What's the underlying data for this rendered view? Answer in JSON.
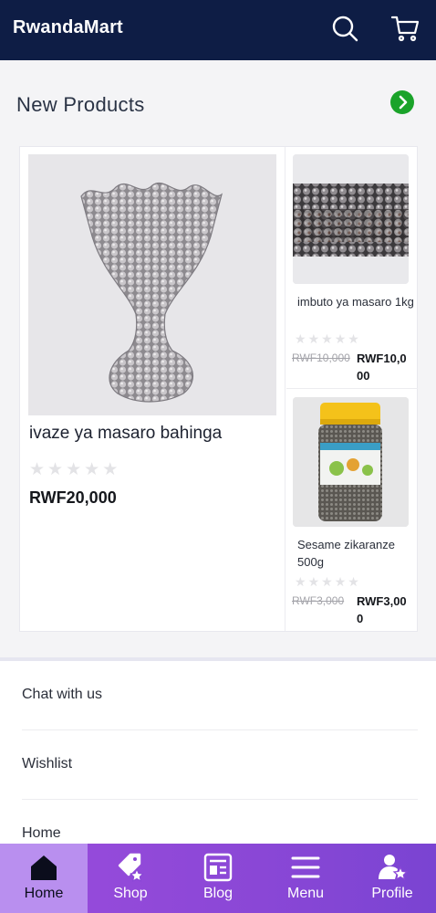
{
  "app": {
    "brand": "RwandaMart",
    "icons": {
      "search": "search-icon",
      "cart": "cart-icon"
    }
  },
  "section": {
    "title": "New Products",
    "more_icon": "chevron-right-icon"
  },
  "products": {
    "featured": {
      "name": "ivaze ya masaro bahinga",
      "rating": 0,
      "price": "RWF20,000"
    },
    "side": [
      {
        "name": "imbuto ya masaro 1kg",
        "rating": 0,
        "old_price": "RWF10,000",
        "price": "RWF10,000"
      },
      {
        "name": "Sesame zikaranze 500g",
        "rating": 0,
        "old_price": "RWF3,000",
        "price": "RWF3,000"
      }
    ]
  },
  "menu": {
    "items": [
      "Chat with us",
      "Wishlist",
      "Home"
    ]
  },
  "bottom_nav": {
    "items": [
      {
        "label": "Home",
        "icon": "home-icon",
        "active": true
      },
      {
        "label": "Shop",
        "icon": "shop-tag-icon",
        "active": false
      },
      {
        "label": "Blog",
        "icon": "blog-icon",
        "active": false
      },
      {
        "label": "Menu",
        "icon": "menu-icon",
        "active": false
      },
      {
        "label": "Profile",
        "icon": "profile-icon",
        "active": false
      }
    ]
  },
  "colors": {
    "header": "#0e1d45",
    "accent_green": "#1aa32a",
    "nav_purple": "#8a47d6",
    "nav_active": "#b98fef"
  }
}
